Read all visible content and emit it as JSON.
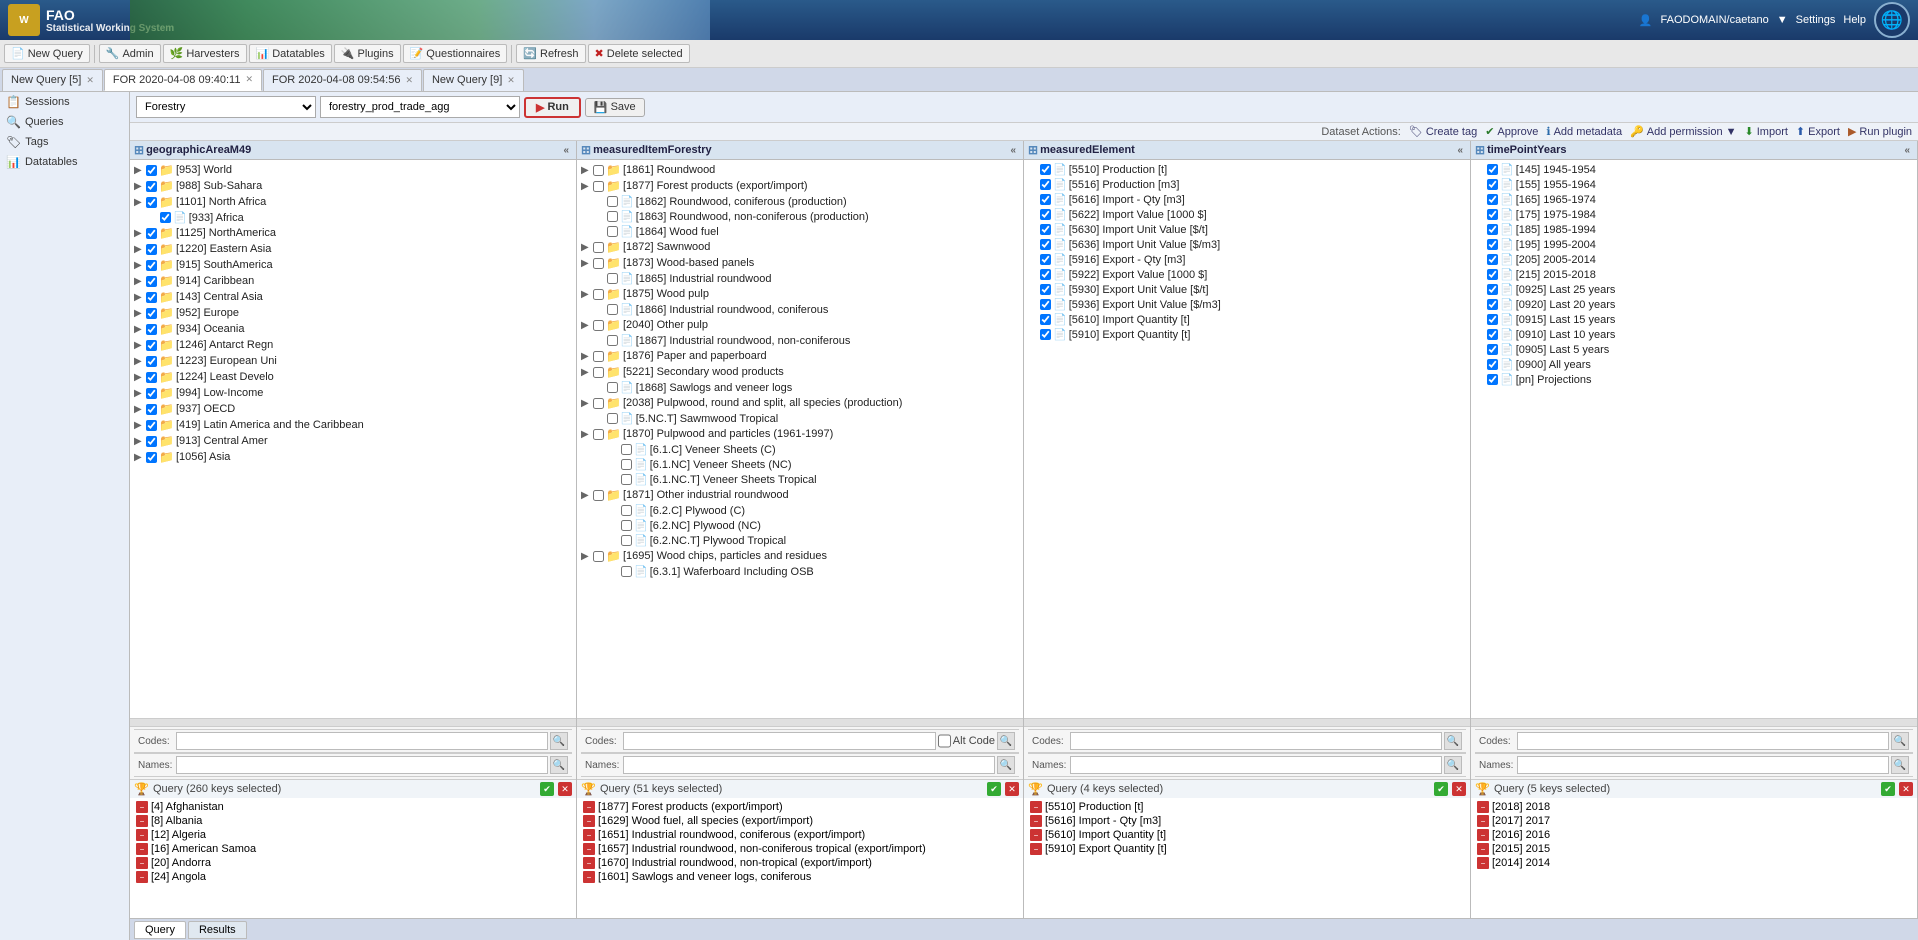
{
  "app": {
    "title": "FAO",
    "subtitle": "Statistical Working System",
    "user": "FAODOMAIN/caetano",
    "globe_icon": "🌐"
  },
  "toolbar": {
    "new_query": "New Query",
    "admin": "Admin",
    "harvesters": "Harvesters",
    "datatables": "Datatables",
    "plugins": "Plugins",
    "questionnaires": "Questionnaires",
    "refresh": "Refresh",
    "delete_selected": "Delete selected",
    "settings": "Settings",
    "help": "Help"
  },
  "tabs": [
    {
      "id": "tab1",
      "label": "New Query [5]",
      "active": false,
      "closable": true
    },
    {
      "id": "tab2",
      "label": "FOR 2020-04-08 09:40:11",
      "active": true,
      "closable": true
    },
    {
      "id": "tab3",
      "label": "FOR 2020-04-08 09:54:56",
      "active": false,
      "closable": true
    },
    {
      "id": "tab4",
      "label": "New Query [9]",
      "active": false,
      "closable": true
    }
  ],
  "sidebar": {
    "items": [
      {
        "id": "sessions",
        "label": "Sessions",
        "icon": "📋"
      },
      {
        "id": "queries",
        "label": "Queries",
        "icon": "🔍"
      },
      {
        "id": "tags",
        "label": "Tags",
        "icon": "🏷"
      },
      {
        "id": "datatables",
        "label": "Datatables",
        "icon": "📊"
      }
    ]
  },
  "query_bar": {
    "domain_value": "Forestry",
    "dataset_value": "forestry_prod_trade_agg",
    "run_label": "Run",
    "save_label": "Save"
  },
  "dataset_actions": {
    "label": "Dataset Actions:",
    "create_tag": "Create tag",
    "approve": "Approve",
    "add_metadata": "Add metadata",
    "add_permission": "Add permission",
    "import": "Import",
    "export": "Export",
    "run_plugin": "Run plugin"
  },
  "panels": [
    {
      "id": "geographicAreaM49",
      "title": "geographicAreaM49",
      "collapse_icon": "«",
      "tree_items": [
        {
          "indent": 0,
          "expand": "▶",
          "checked": true,
          "folder": true,
          "label": "[953] World"
        },
        {
          "indent": 0,
          "expand": "▶",
          "checked": true,
          "folder": true,
          "label": "[988] Sub-Sahara"
        },
        {
          "indent": 0,
          "expand": "▶",
          "checked": true,
          "folder": true,
          "label": "[1101] North Africa"
        },
        {
          "indent": 1,
          "expand": "",
          "checked": true,
          "folder": false,
          "label": "[933] Africa"
        },
        {
          "indent": 0,
          "expand": "▶",
          "checked": true,
          "folder": true,
          "label": "[1125] NorthAmerica"
        },
        {
          "indent": 0,
          "expand": "▶",
          "checked": true,
          "folder": true,
          "label": "[1220] Eastern Asia"
        },
        {
          "indent": 0,
          "expand": "▶",
          "checked": true,
          "folder": true,
          "label": "[915] SouthAmerica"
        },
        {
          "indent": 0,
          "expand": "▶",
          "checked": true,
          "folder": true,
          "label": "[914] Caribbean"
        },
        {
          "indent": 0,
          "expand": "▶",
          "checked": true,
          "folder": true,
          "label": "[143] Central Asia"
        },
        {
          "indent": 0,
          "expand": "▶",
          "checked": true,
          "folder": true,
          "label": "[952] Europe"
        },
        {
          "indent": 0,
          "expand": "▶",
          "checked": true,
          "folder": true,
          "label": "[934] Oceania"
        },
        {
          "indent": 0,
          "expand": "▶",
          "checked": true,
          "folder": true,
          "label": "[1246] Antarct Regn"
        },
        {
          "indent": 0,
          "expand": "▶",
          "checked": true,
          "folder": true,
          "label": "[1223] European Uni"
        },
        {
          "indent": 0,
          "expand": "▶",
          "checked": true,
          "folder": true,
          "label": "[1224] Least Develo"
        },
        {
          "indent": 0,
          "expand": "▶",
          "checked": true,
          "folder": true,
          "label": "[994] Low-Income"
        },
        {
          "indent": 0,
          "expand": "▶",
          "checked": true,
          "folder": true,
          "label": "[937] OECD"
        },
        {
          "indent": 0,
          "expand": "▶",
          "checked": true,
          "folder": true,
          "label": "[419] Latin America and the Caribbean"
        },
        {
          "indent": 0,
          "expand": "▶",
          "checked": true,
          "folder": true,
          "label": "[913] Central Amer"
        },
        {
          "indent": 0,
          "expand": "▶",
          "checked": true,
          "folder": true,
          "label": "[1056] Asia"
        }
      ],
      "search_codes_placeholder": "",
      "search_names_placeholder": "",
      "query_label": "Query (260 keys selected)",
      "query_items": [
        "[4] Afghanistan",
        "[8] Albania",
        "[12] Algeria",
        "[16] American Samoa",
        "[20] Andorra",
        "[24] Angola"
      ]
    },
    {
      "id": "measuredItemForestry",
      "title": "measuredItemForestry",
      "collapse_icon": "«",
      "tree_items": [
        {
          "indent": 0,
          "expand": "▶",
          "checked": false,
          "folder": true,
          "label": "[1861] Roundwood"
        },
        {
          "indent": 0,
          "expand": "▶",
          "checked": false,
          "folder": true,
          "label": "[1877] Forest products (export/import)"
        },
        {
          "indent": 1,
          "expand": "",
          "checked": false,
          "folder": false,
          "label": "[1862] Roundwood, coniferous (production)"
        },
        {
          "indent": 1,
          "expand": "",
          "checked": false,
          "folder": false,
          "label": "[1863] Roundwood, non-coniferous (production)"
        },
        {
          "indent": 1,
          "expand": "",
          "checked": false,
          "folder": false,
          "label": "[1864] Wood fuel"
        },
        {
          "indent": 0,
          "expand": "▶",
          "checked": false,
          "folder": true,
          "label": "[1872] Sawnwood"
        },
        {
          "indent": 0,
          "expand": "▶",
          "checked": false,
          "folder": true,
          "label": "[1873] Wood-based panels"
        },
        {
          "indent": 1,
          "expand": "",
          "checked": false,
          "folder": false,
          "label": "[1865] Industrial roundwood"
        },
        {
          "indent": 0,
          "expand": "▶",
          "checked": false,
          "folder": true,
          "label": "[1875] Wood pulp"
        },
        {
          "indent": 1,
          "expand": "",
          "checked": false,
          "folder": false,
          "label": "[1866] Industrial roundwood, coniferous"
        },
        {
          "indent": 0,
          "expand": "▶",
          "checked": false,
          "folder": true,
          "label": "[2040] Other pulp"
        },
        {
          "indent": 1,
          "expand": "",
          "checked": false,
          "folder": false,
          "label": "[1867] Industrial roundwood, non-coniferous"
        },
        {
          "indent": 0,
          "expand": "▶",
          "checked": false,
          "folder": true,
          "label": "[1876] Paper and paperboard"
        },
        {
          "indent": 0,
          "expand": "▶",
          "checked": false,
          "folder": true,
          "label": "[5221] Secondary wood products"
        },
        {
          "indent": 1,
          "expand": "",
          "checked": false,
          "folder": false,
          "label": "[1868] Sawlogs and veneer logs"
        },
        {
          "indent": 0,
          "expand": "▶",
          "checked": false,
          "folder": true,
          "label": "[2038] Pulpwood, round and split, all species (production)"
        },
        {
          "indent": 1,
          "expand": "",
          "checked": false,
          "folder": false,
          "label": "[5.NC.T] Sawmwood Tropical"
        },
        {
          "indent": 0,
          "expand": "▶",
          "checked": false,
          "folder": true,
          "label": "[1870] Pulpwood and particles (1961-1997)"
        },
        {
          "indent": 2,
          "expand": "",
          "checked": false,
          "folder": false,
          "label": "[6.1.C] Veneer Sheets (C)"
        },
        {
          "indent": 2,
          "expand": "",
          "checked": false,
          "folder": false,
          "label": "[6.1.NC] Veneer Sheets (NC)"
        },
        {
          "indent": 2,
          "expand": "",
          "checked": false,
          "folder": false,
          "label": "[6.1.NC.T] Veneer Sheets Tropical"
        },
        {
          "indent": 0,
          "expand": "▶",
          "checked": false,
          "folder": true,
          "label": "[1871] Other industrial roundwood"
        },
        {
          "indent": 2,
          "expand": "",
          "checked": false,
          "folder": false,
          "label": "[6.2.C] Plywood (C)"
        },
        {
          "indent": 2,
          "expand": "",
          "checked": false,
          "folder": false,
          "label": "[6.2.NC] Plywood (NC)"
        },
        {
          "indent": 2,
          "expand": "",
          "checked": false,
          "folder": false,
          "label": "[6.2.NC.T] Plywood Tropical"
        },
        {
          "indent": 0,
          "expand": "▶",
          "checked": false,
          "folder": true,
          "label": "[1695] Wood chips, particles and residues"
        },
        {
          "indent": 2,
          "expand": "",
          "checked": false,
          "folder": false,
          "label": "[6.3.1] Waferboard Including OSB"
        }
      ],
      "search_codes_placeholder": "",
      "search_names_placeholder": "",
      "altcode_label": "Alt Code",
      "query_label": "Query (51 keys selected)",
      "query_items": [
        "[1877] Forest products (export/import)",
        "[1629] Wood fuel, all species (export/import)",
        "[1651] Industrial roundwood, coniferous (export/import)",
        "[1657] Industrial roundwood, non-coniferous tropical (export/import)",
        "[1670] Industrial roundwood, non-tropical (export/import)",
        "[1601] Sawlogs and veneer logs, coniferous"
      ]
    },
    {
      "id": "measuredElement",
      "title": "measuredElement",
      "collapse_icon": "«",
      "tree_items": [
        {
          "indent": 0,
          "expand": "",
          "checked": true,
          "folder": false,
          "label": "[5510] Production [t]"
        },
        {
          "indent": 0,
          "expand": "",
          "checked": true,
          "folder": false,
          "label": "[5516] Production [m3]"
        },
        {
          "indent": 0,
          "expand": "",
          "checked": true,
          "folder": false,
          "label": "[5616] Import - Qty [m3]"
        },
        {
          "indent": 0,
          "expand": "",
          "checked": true,
          "folder": false,
          "label": "[5622] Import Value [1000 $]"
        },
        {
          "indent": 0,
          "expand": "",
          "checked": true,
          "folder": false,
          "label": "[5630] Import Unit Value [$/t]"
        },
        {
          "indent": 0,
          "expand": "",
          "checked": true,
          "folder": false,
          "label": "[5636] Import Unit Value [$/m3]"
        },
        {
          "indent": 0,
          "expand": "",
          "checked": true,
          "folder": false,
          "label": "[5916] Export - Qty [m3]"
        },
        {
          "indent": 0,
          "expand": "",
          "checked": true,
          "folder": false,
          "label": "[5922] Export Value [1000 $]"
        },
        {
          "indent": 0,
          "expand": "",
          "checked": true,
          "folder": false,
          "label": "[5930] Export Unit Value [$/t]"
        },
        {
          "indent": 0,
          "expand": "",
          "checked": true,
          "folder": false,
          "label": "[5936] Export Unit Value [$/m3]"
        },
        {
          "indent": 0,
          "expand": "",
          "checked": true,
          "folder": false,
          "label": "[5610] Import Quantity [t]"
        },
        {
          "indent": 0,
          "expand": "",
          "checked": true,
          "folder": false,
          "label": "[5910] Export Quantity [t]"
        }
      ],
      "search_codes_placeholder": "",
      "search_names_placeholder": "",
      "query_label": "Query (4 keys selected)",
      "query_items": [
        "[5510] Production [t]",
        "[5616] Import - Qty [m3]",
        "[5610] Import Quantity [t]",
        "[5910] Export Quantity [t]"
      ]
    },
    {
      "id": "timePointYears",
      "title": "timePointYears",
      "collapse_icon": "«",
      "tree_items": [
        {
          "indent": 0,
          "expand": "",
          "checked": true,
          "folder": false,
          "label": "[145] 1945-1954"
        },
        {
          "indent": 0,
          "expand": "",
          "checked": true,
          "folder": false,
          "label": "[155] 1955-1964"
        },
        {
          "indent": 0,
          "expand": "",
          "checked": true,
          "folder": false,
          "label": "[165] 1965-1974"
        },
        {
          "indent": 0,
          "expand": "",
          "checked": true,
          "folder": false,
          "label": "[175] 1975-1984"
        },
        {
          "indent": 0,
          "expand": "",
          "checked": true,
          "folder": false,
          "label": "[185] 1985-1994"
        },
        {
          "indent": 0,
          "expand": "",
          "checked": true,
          "folder": false,
          "label": "[195] 1995-2004"
        },
        {
          "indent": 0,
          "expand": "",
          "checked": true,
          "folder": false,
          "label": "[205] 2005-2014"
        },
        {
          "indent": 0,
          "expand": "",
          "checked": true,
          "folder": false,
          "label": "[215] 2015-2018"
        },
        {
          "indent": 0,
          "expand": "",
          "checked": true,
          "folder": false,
          "label": "[0925] Last 25 years"
        },
        {
          "indent": 0,
          "expand": "",
          "checked": true,
          "folder": false,
          "label": "[0920] Last 20 years"
        },
        {
          "indent": 0,
          "expand": "",
          "checked": true,
          "folder": false,
          "label": "[0915] Last 15 years"
        },
        {
          "indent": 0,
          "expand": "",
          "checked": true,
          "folder": false,
          "label": "[0910] Last 10 years"
        },
        {
          "indent": 0,
          "expand": "",
          "checked": true,
          "folder": false,
          "label": "[0905] Last 5 years"
        },
        {
          "indent": 0,
          "expand": "",
          "checked": true,
          "folder": false,
          "label": "[0900] All years"
        },
        {
          "indent": 0,
          "expand": "",
          "checked": true,
          "folder": false,
          "label": "[pn] Projections"
        }
      ],
      "search_codes_placeholder": "",
      "search_names_placeholder": "",
      "query_label": "Query (5 keys selected)",
      "query_items": [
        "[2018] 2018",
        "[2017] 2017",
        "[2016] 2016",
        "[2015] 2015",
        "[2014] 2014"
      ]
    }
  ],
  "bottom_bar": {
    "query_tab": "Query",
    "results_tab": "Results"
  }
}
